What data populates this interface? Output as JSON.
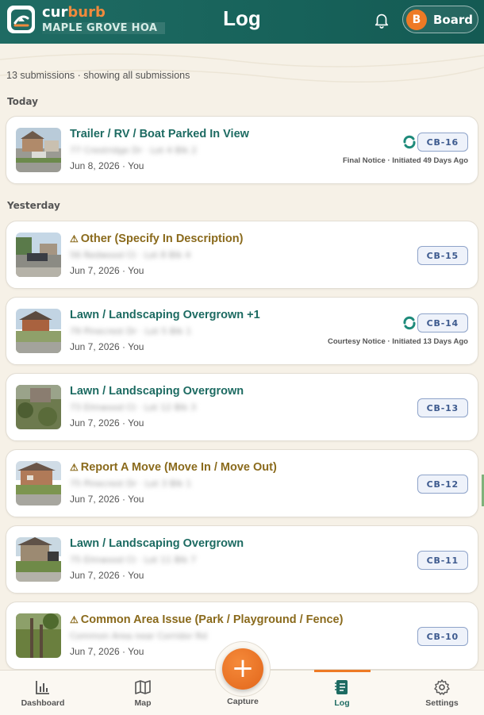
{
  "header": {
    "brand_part1": "cur",
    "brand_part2": "burb",
    "org_name": "MAPLE GROVE HOA",
    "title": "Log",
    "user_initial": "B",
    "user_label": "Board"
  },
  "summary": "13 submissions · showing all submissions",
  "sections": [
    {
      "label": "Today"
    },
    {
      "label": "Yesterday"
    }
  ],
  "cards": [
    {
      "title": "Trailer / RV / Boat Parked In View",
      "warning": false,
      "address": "77 Crestridge Dr · Lot 4 Blk 2",
      "meta": "Jun 8, 2026 · You",
      "id": "CB-16",
      "synced": true,
      "notice": "Final Notice · Initiated 49 Days Ago"
    },
    {
      "title": "Other (Specify In Description)",
      "warning": true,
      "address": "56 Redwood Ct · Lot 8 Blk 4",
      "meta": "Jun 7, 2026 · You",
      "id": "CB-15",
      "synced": false,
      "notice": ""
    },
    {
      "title": "Lawn / Landscaping Overgrown +1",
      "warning": false,
      "address": "79 Pinecrest Dr · Lot 5 Blk 1",
      "meta": "Jun 7, 2026 · You",
      "id": "CB-14",
      "synced": true,
      "notice": "Courtesy Notice · Initiated 13 Days Ago"
    },
    {
      "title": "Lawn / Landscaping Overgrown",
      "warning": false,
      "address": "73 Elmwood Ct · Lot 12 Blk 3",
      "meta": "Jun 7, 2026 · You",
      "id": "CB-13",
      "synced": false,
      "notice": ""
    },
    {
      "title": "Report A Move (Move In / Move Out)",
      "warning": true,
      "address": "75 Pinecrest Dr · Lot 3 Blk 1",
      "meta": "Jun 7, 2026 · You",
      "id": "CB-12",
      "synced": false,
      "notice": ""
    },
    {
      "title": "Lawn / Landscaping Overgrown",
      "warning": false,
      "address": "75 Elmwood Ct · Lot 11 Blk 7",
      "meta": "Jun 7, 2026 · You",
      "id": "CB-11",
      "synced": false,
      "notice": ""
    },
    {
      "title": "Common Area Issue (Park / Playground / Fence)",
      "warning": true,
      "address": "Common Area near Corridor Rd",
      "meta": "Jun 7, 2026 · You",
      "id": "CB-10",
      "synced": false,
      "notice": ""
    }
  ],
  "nav": {
    "dashboard": "Dashboard",
    "map": "Map",
    "capture": "Capture",
    "log": "Log",
    "settings": "Settings"
  },
  "colors": {
    "header": "#1f6b63",
    "accent": "#ee7a25",
    "title_green": "#1d6b62",
    "title_warn": "#8a6a1c",
    "badge_border": "#8ea3c9"
  }
}
